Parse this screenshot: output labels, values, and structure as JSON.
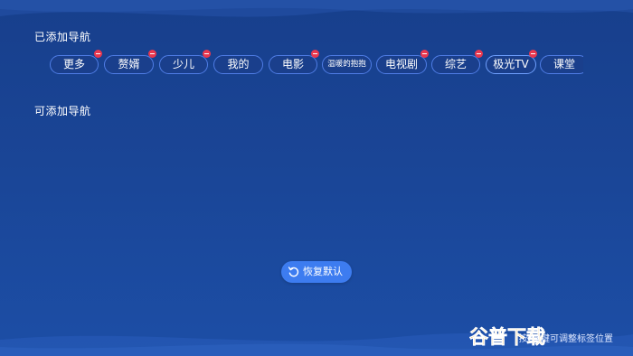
{
  "sections": {
    "added_title": "已添加导航",
    "available_title": "可添加导航"
  },
  "added_tabs": [
    {
      "label": "更多",
      "removable": true
    },
    {
      "label": "赘婿",
      "removable": true
    },
    {
      "label": "少儿",
      "removable": true
    },
    {
      "label": "我的",
      "removable": false
    },
    {
      "label": "电影",
      "removable": true
    },
    {
      "label": "温暖的抱抱",
      "removable": false
    },
    {
      "label": "电视剧",
      "removable": true
    },
    {
      "label": "综艺",
      "removable": true
    },
    {
      "label": "极光TV",
      "removable": true
    },
    {
      "label": "课堂",
      "removable": false
    }
  ],
  "reset_button": {
    "label": "恢复默认",
    "icon": "refresh-icon"
  },
  "hint": {
    "text": "按OK键可调整标签位置"
  },
  "watermark": {
    "text": "谷普下载"
  },
  "colors": {
    "background": "#1a4596",
    "tab_border": "#4f7de6",
    "remove_badge": "#e8384f",
    "reset_button": "#3d7cf0"
  }
}
